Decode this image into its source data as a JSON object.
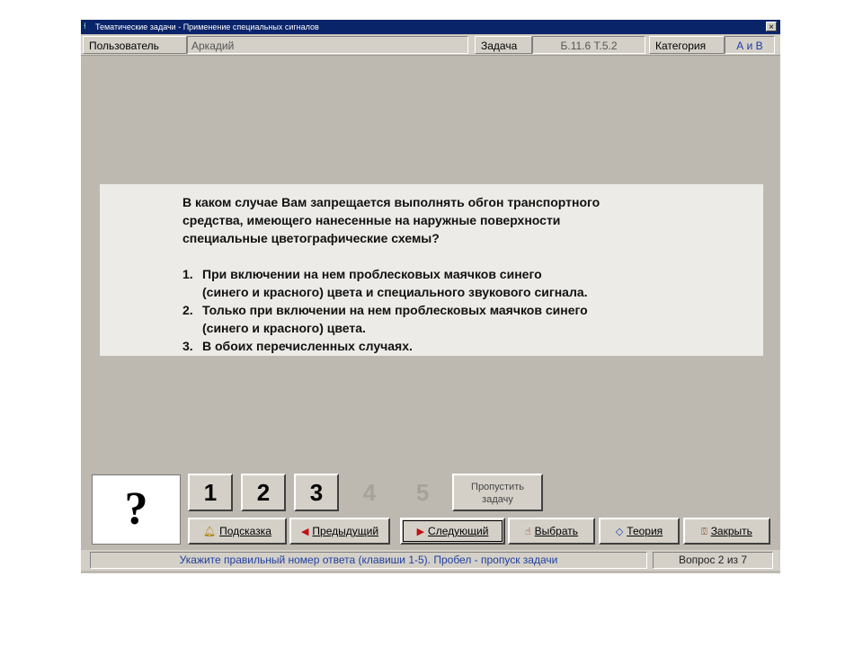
{
  "window": {
    "title": "Тематические задачи - Применение специальных сигналов",
    "close_glyph": "×"
  },
  "info_bar": {
    "user_label": "Пользователь",
    "user_value": "Аркадий",
    "task_label": "Задача",
    "task_value": "Б.11.6  Т.5.2",
    "category_label": "Категория",
    "category_value": "А и В"
  },
  "question": {
    "lines": [
      "В каком случае Вам запрещается выполнять обгон транспортного",
      "средства, имеющего нанесенные на наружные поверхности",
      "специальные цветографические схемы?"
    ],
    "answers": [
      {
        "num": "1.",
        "lines": [
          "При включении на нем проблесковых маячков синего",
          "(синего и красного) цвета и специального звукового сигнала."
        ]
      },
      {
        "num": "2.",
        "lines": [
          "Только при включении на нем проблесковых маячков синего",
          "(синего и красного) цвета."
        ]
      },
      {
        "num": "3.",
        "lines": [
          "В обоих перечисленных случаях."
        ]
      }
    ]
  },
  "answer_indicator": "?",
  "number_buttons": [
    "1",
    "2",
    "3",
    "4",
    "5"
  ],
  "skip_button": {
    "line1": "Пропустить",
    "line2": "задачу"
  },
  "action_buttons": {
    "hint": {
      "icon": "bell-icon",
      "label": "Подсказка"
    },
    "previous": {
      "icon": "arrow-left-icon",
      "label": "Предыдущий"
    },
    "next": {
      "icon": "arrow-right-icon",
      "label": "Следующий"
    },
    "choose": {
      "icon": "hand-icon",
      "label": "Выбрать"
    },
    "theory": {
      "icon": "diamond-icon",
      "label": "Теория"
    },
    "close": {
      "icon": "person-exit-icon",
      "label": "Закрыть"
    }
  },
  "status_bar": {
    "hint_text": "Укажите правильный номер ответа (клавиши 1-5). Пробел - пропуск задачи",
    "progress_text": "Вопрос 2 из 7"
  },
  "colors": {
    "window_bg": "#bdb9b1",
    "title_bar": "#0a246a",
    "status_text": "#2040a0",
    "arrow_red": "#c01010"
  }
}
